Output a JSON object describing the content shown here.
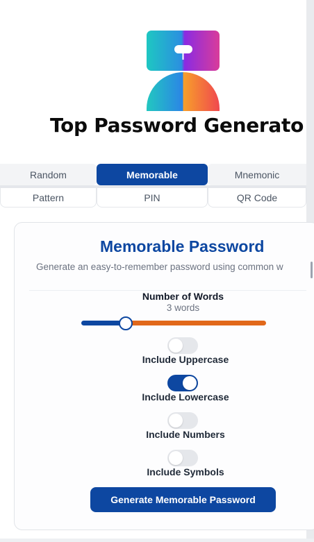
{
  "app": {
    "title": "Top Password Generato"
  },
  "colors": {
    "primary": "#0d47a1",
    "accent": "#e1681a"
  },
  "tabs": {
    "row1": [
      {
        "label": "Random",
        "active": false
      },
      {
        "label": "Memorable",
        "active": true
      },
      {
        "label": "Mnemonic",
        "active": false
      }
    ],
    "row2": [
      {
        "label": "Pattern"
      },
      {
        "label": "PIN"
      },
      {
        "label": "QR Code"
      }
    ]
  },
  "card": {
    "title": "Memorable Password",
    "description": "Generate an easy-to-remember password using common w",
    "words": {
      "label": "Number of Words",
      "value_text": "3 words",
      "value": 3
    },
    "options": [
      {
        "label": "Include Uppercase",
        "enabled": false
      },
      {
        "label": "Include Lowercase",
        "enabled": true
      },
      {
        "label": "Include Numbers",
        "enabled": false
      },
      {
        "label": "Include Symbols",
        "enabled": false
      }
    ],
    "generate_label": "Generate Memorable Password"
  }
}
